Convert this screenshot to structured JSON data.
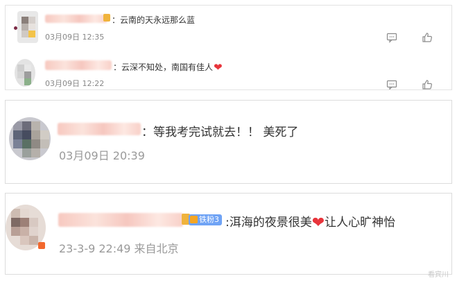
{
  "comments": [
    {
      "text": "：云南的天永远那么蓝",
      "time": "03月09日 12:35",
      "reply_icon": "comment-icon",
      "like_icon": "thumbs-up-icon"
    },
    {
      "text": "：云深不知处，南国有佳人",
      "emoji": "❤",
      "time": "03月09日 12:22",
      "reply_icon": "comment-icon",
      "like_icon": "thumbs-up-icon"
    },
    {
      "text": "：等我考完试就去！！ 美死了",
      "time": "03月09日 20:39"
    },
    {
      "badge": "铁粉3",
      "text_before": ":洱海的夜景很美",
      "emoji": "❤",
      "text_after": "让人心旷神怡",
      "time": "23-3-9 22:49 来自北京"
    }
  ],
  "watermark": "看宾川",
  "colors": {
    "heart": "#e8343b",
    "badge": "#6fa3f5",
    "meta_text": "#999999",
    "border": "#dcdcdc"
  }
}
